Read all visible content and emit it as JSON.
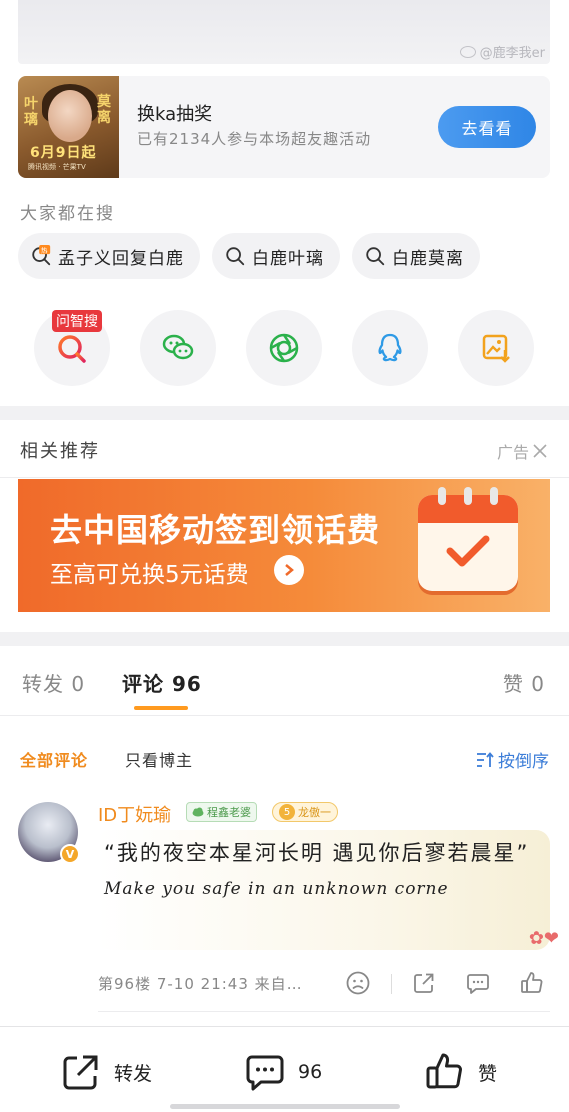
{
  "watermark": "@鹿李我er",
  "promo": {
    "thumb_left": "叶璃",
    "thumb_right": "莫离",
    "thumb_date": "6月9日起",
    "thumb_small": "腾讯视频 · 芒果TV",
    "title": "换ka抽奖",
    "subtitle": "已有2134人参与本场超友趣活动",
    "button": "去看看"
  },
  "search": {
    "label": "大家都在搜",
    "chips": [
      {
        "icon": "hot-search-icon",
        "text": "孟子义回复白鹿"
      },
      {
        "icon": "search-icon",
        "text": "白鹿叶璃"
      },
      {
        "icon": "search-icon",
        "text": "白鹿莫离"
      }
    ]
  },
  "share": {
    "ask_badge": "问智搜",
    "items": [
      "ask-search-icon",
      "wechat-icon",
      "moments-icon",
      "qq-icon",
      "save-image-icon"
    ]
  },
  "recommend": {
    "label": "相关推荐",
    "ad_tag": "广告",
    "banner_title": "去中国移动签到领话费",
    "banner_sub": "至高可兑换5元话费"
  },
  "tabs": {
    "repost": "转发 0",
    "comments": "评论 96",
    "likes": "赞 0"
  },
  "filter": {
    "all": "全部评论",
    "owner_only": "只看博主",
    "sort": "按倒序"
  },
  "comment": {
    "username": "ID丁妧瑜",
    "medal1": "程鑫老婆",
    "medal2_level": "5",
    "medal2": "龙傲一",
    "text": "“我的夜空本星河长明 遇见你后寥若晨星”",
    "text_script": "Make you safe in an unknown corne",
    "meta": "第96楼 7-10 21:43 来自…"
  },
  "bottom": {
    "repost": "转发",
    "comments": "96",
    "like": "赞"
  },
  "colors": {
    "accent_orange": "#f08b1e",
    "link_blue": "#3d7ed8",
    "button_blue": "#2f86e6"
  }
}
